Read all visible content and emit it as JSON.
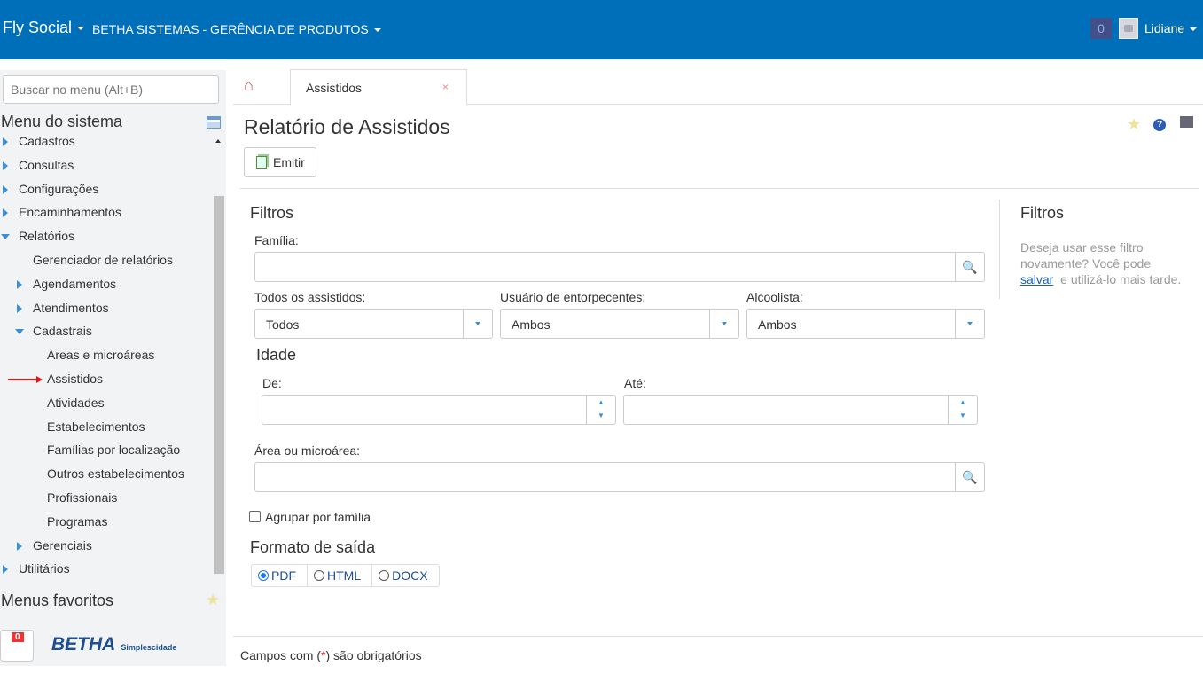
{
  "header": {
    "brand": "Fly Social",
    "org": "BETHA SISTEMAS - GERÊNCIA DE PRODUTOS",
    "notifications": "0",
    "user": "Lidiane",
    "color": "#006fb9"
  },
  "sidebar": {
    "search_placeholder": "Buscar no menu (Alt+B)",
    "title": "Menu do sistema",
    "items": [
      {
        "label": "Cadastros",
        "level": 0,
        "arrow": "right"
      },
      {
        "label": "Consultas",
        "level": 0,
        "arrow": "right"
      },
      {
        "label": "Configurações",
        "level": 0,
        "arrow": "right"
      },
      {
        "label": "Encaminhamentos",
        "level": 0,
        "arrow": "right"
      },
      {
        "label": "Relatórios",
        "level": 0,
        "arrow": "down"
      },
      {
        "label": "Gerenciador de relatórios",
        "level": 1,
        "arrow": ""
      },
      {
        "label": "Agendamentos",
        "level": 1,
        "arrow": "right"
      },
      {
        "label": "Atendimentos",
        "level": 1,
        "arrow": "right"
      },
      {
        "label": "Cadastrais",
        "level": 1,
        "arrow": "down"
      },
      {
        "label": "Áreas e microáreas",
        "level": 2,
        "arrow": ""
      },
      {
        "label": "Assistidos",
        "level": 2,
        "arrow": "",
        "marked": true
      },
      {
        "label": "Atividades",
        "level": 2,
        "arrow": ""
      },
      {
        "label": "Estabelecimentos",
        "level": 2,
        "arrow": ""
      },
      {
        "label": "Famílias por localização",
        "level": 2,
        "arrow": ""
      },
      {
        "label": "Outros estabelecimentos",
        "level": 2,
        "arrow": ""
      },
      {
        "label": "Profissionais",
        "level": 2,
        "arrow": ""
      },
      {
        "label": "Programas",
        "level": 2,
        "arrow": ""
      },
      {
        "label": "Gerenciais",
        "level": 1,
        "arrow": "right"
      },
      {
        "label": "Utilitários",
        "level": 0,
        "arrow": "right"
      }
    ],
    "favorites": "Menus favoritos",
    "help_badge": "0",
    "logo": "BETHA",
    "logo_tag": "Simplescidade"
  },
  "tabs": [
    {
      "label": "Assistidos",
      "close": "×"
    }
  ],
  "page": {
    "title": "Relatório de Assistidos",
    "emit": "Emitir"
  },
  "filters": {
    "title": "Filtros",
    "familia_label": "Família:",
    "familia_value": "",
    "todos_label": "Todos os assistidos:",
    "todos_value": "Todos",
    "entorp_label": "Usuário de entorpecentes:",
    "entorp_value": "Ambos",
    "alcool_label": "Alcoolista:",
    "alcool_value": "Ambos",
    "idade_title": "Idade",
    "de_label": "De:",
    "de_value": "",
    "ate_label": "Até:",
    "ate_value": "",
    "area_label": "Área ou microárea:",
    "area_value": "",
    "agrupar_label": "Agrupar por família",
    "agrupar_checked": false,
    "formato_title": "Formato de saída",
    "formats": [
      "PDF",
      "HTML",
      "DOCX"
    ],
    "selected_format": "PDF"
  },
  "aside": {
    "title": "Filtros",
    "text1": "Deseja usar esse filtro novamente? Você pode",
    "link": "salvar",
    "text2": "e utilizá-lo mais tarde."
  },
  "footer": {
    "pre": "Campos com (",
    "mark": "*",
    "post": ") são obrigatórios"
  }
}
